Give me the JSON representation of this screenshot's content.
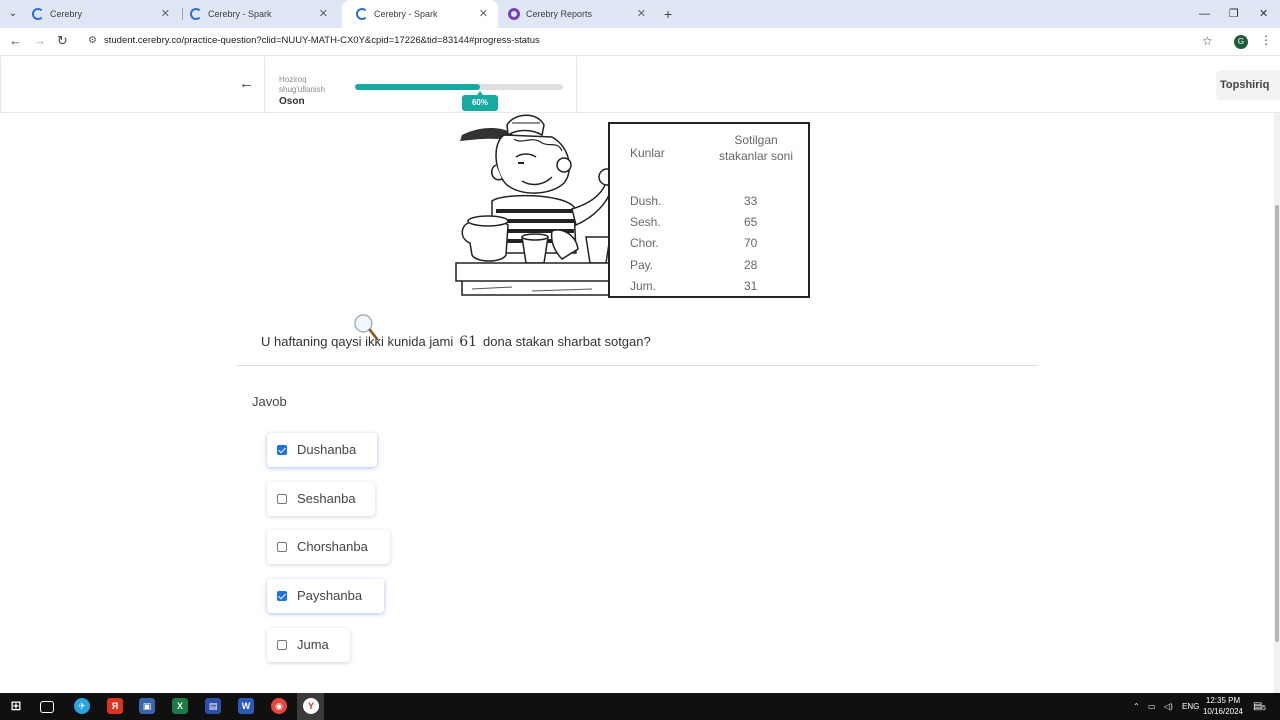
{
  "browser": {
    "tabs": [
      {
        "title": "Cerebry",
        "active": false
      },
      {
        "title": "Cerebry - Spark",
        "active": false
      },
      {
        "title": "Cerebry - Spark",
        "active": true
      },
      {
        "title": "Cerebry Reports",
        "active": false
      }
    ],
    "new_tab": "+",
    "url": "student.cerebry.co/practice-question?clid=NUUY-MATH-CX0Y&cpid=17226&tid=83144#progress-status",
    "profile_initial": "G"
  },
  "header": {
    "level_label": "Hoziroq shug'ullanish",
    "level_value": "Oson",
    "progress_percent": 60,
    "progress_label": "60%",
    "topshiriq_label": "Topshiriq"
  },
  "table": {
    "col_day": "Kunlar",
    "col_count": "Sotilgan stakanlar soni",
    "rows": [
      {
        "day": "Dush.",
        "value": "33"
      },
      {
        "day": "Sesh.",
        "value": "65"
      },
      {
        "day": "Chor.",
        "value": "70"
      },
      {
        "day": "Pay.",
        "value": "28"
      },
      {
        "day": "Jum.",
        "value": "31"
      }
    ]
  },
  "question": {
    "text_before": "U haftaning qaysi ikki kunida jami",
    "number": "61",
    "text_after": "dona stakan sharbat sotgan?"
  },
  "answer": {
    "label": "Javob",
    "options": [
      {
        "label": "Dushanba",
        "checked": true
      },
      {
        "label": "Seshanba",
        "checked": false
      },
      {
        "label": "Chorshanba",
        "checked": false
      },
      {
        "label": "Payshanba",
        "checked": true
      },
      {
        "label": "Juma",
        "checked": false
      }
    ]
  },
  "taskbar": {
    "language": "ENG",
    "time": "12:35 PM",
    "date": "10/16/2024",
    "notification_count": "5"
  }
}
